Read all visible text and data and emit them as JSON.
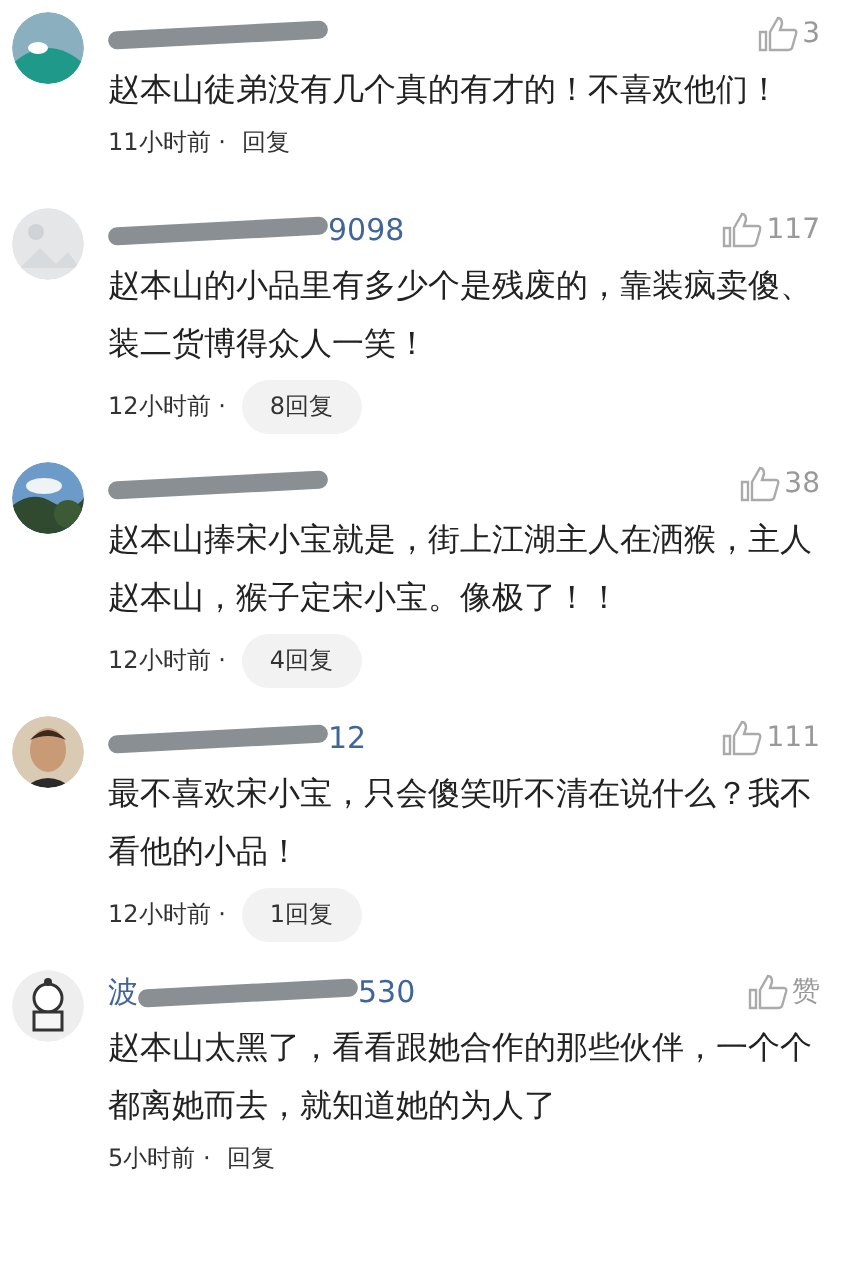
{
  "comments": [
    {
      "likes": "3",
      "text": "赵本山徒弟没有几个真的有才的！不喜欢他们！",
      "time": "11小时前 ·",
      "reply": "回复",
      "kind": "plain"
    },
    {
      "name_suffix": "9098",
      "likes": "117",
      "text": "赵本山的小品里有多少个是残废的，靠装疯卖傻、装二货博得众人一笑！",
      "time": "12小时前 ·",
      "reply": "8回复",
      "kind": "chip"
    },
    {
      "likes": "38",
      "text": "赵本山捧宋小宝就是，街上江湖主人在洒猴，主人赵本山，猴子定宋小宝。像极了！！",
      "time": "12小时前 ·",
      "reply": "4回复",
      "kind": "chip"
    },
    {
      "name_suffix": "12",
      "likes": "111",
      "text": "最不喜欢宋小宝，只会傻笑听不清在说什么？我不看他的小品！",
      "time": "12小时前 ·",
      "reply": "1回复",
      "kind": "chip"
    },
    {
      "name_prefix": "波",
      "name_suffix": "530",
      "likes": "赞",
      "text": "赵本山太黑了，看看跟她合作的那些伙伴，一个个都离她而去，就知道她的为人了",
      "time": "5小时前 ·",
      "reply": "回复",
      "kind": "plain"
    }
  ]
}
